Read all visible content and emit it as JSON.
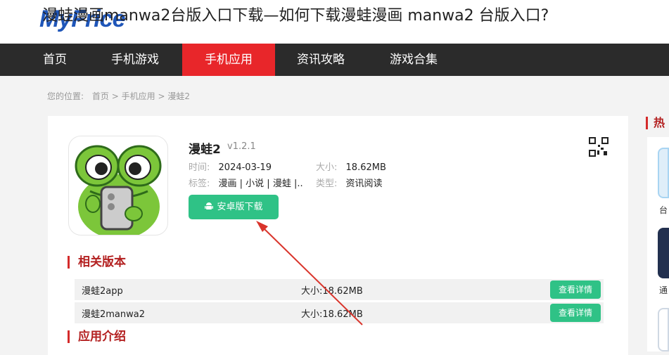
{
  "header": {
    "logo_text": "MyFrice",
    "overlay_title": "漫蛙漫画manwa2台版入口下载—如何下载漫蛙漫画 manwa2 台版入口?"
  },
  "nav": {
    "items": [
      "首页",
      "手机游戏",
      "手机应用",
      "资讯攻略",
      "游戏合集"
    ],
    "active": "手机应用"
  },
  "breadcrumb": {
    "prefix": "您的位置:",
    "items": [
      "首页",
      "手机应用",
      "漫蛙2"
    ],
    "separator": ">"
  },
  "app": {
    "name": "漫蛙2",
    "version": "v1.2.1",
    "time_label": "时间:",
    "time_value": "2024-03-19",
    "size_label": "大小:",
    "size_value": "18.62MB",
    "tags_label": "标签:",
    "tags_value": "漫画 | 小说 | 漫蛙 |..",
    "type_label": "类型:",
    "type_value": "资讯阅读",
    "download_label": "安卓版下载"
  },
  "related": {
    "title": "相关版本",
    "rows": [
      {
        "name": "漫蛙2app",
        "size": "大小:18.62MB",
        "action": "查看详情"
      },
      {
        "name": "漫蛙2manwa2",
        "size": "大小:18.62MB",
        "action": "查看详情"
      }
    ]
  },
  "intro": {
    "title": "应用介绍"
  },
  "sidebar": {
    "title": "热",
    "snippets": [
      "台",
      "通"
    ]
  },
  "colors": {
    "nav_bg": "#2b2b2b",
    "nav_active": "#e8262a",
    "accent_green": "#2fc286",
    "section_red": "#d42a2a",
    "logo_blue": "#1f56b9",
    "arrow_red": "#d9342b"
  }
}
